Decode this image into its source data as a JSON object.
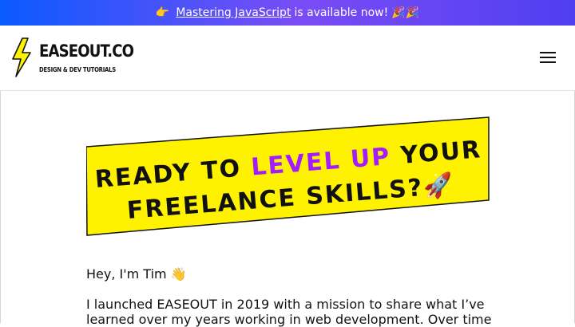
{
  "announcement": {
    "lead_emoji": "👉",
    "link_text": "Mastering JavaScript",
    "text": "is available now!",
    "trailing_emoji": "🎉🎉"
  },
  "header": {
    "brand": "EASEOUT.CO",
    "tagline": "DESIGN & DEV TUTORIALS",
    "icons": {
      "logo": "lightning-bolt-icon",
      "menu": "hamburger-menu-icon"
    }
  },
  "banner": {
    "line1_prefix": "READY TO",
    "line1_highlight": "LEVEL UP",
    "line1_suffix": "YOUR",
    "line2": "FREELANCE SKILLS?",
    "emoji": "🚀",
    "colors": {
      "background": "#fff200",
      "highlight": "#a21cff",
      "text": "#111111"
    }
  },
  "content": {
    "greeting": "Hey, I'm Tim 👋",
    "intro": "I launched EASEOUT in 2019 with a mission to share what I’ve learned over my years working in web development. Over time"
  },
  "colors": {
    "announce_start": "#0a5bff",
    "announce_end": "#7a4cf5",
    "logo_bolt": "#fff200"
  }
}
